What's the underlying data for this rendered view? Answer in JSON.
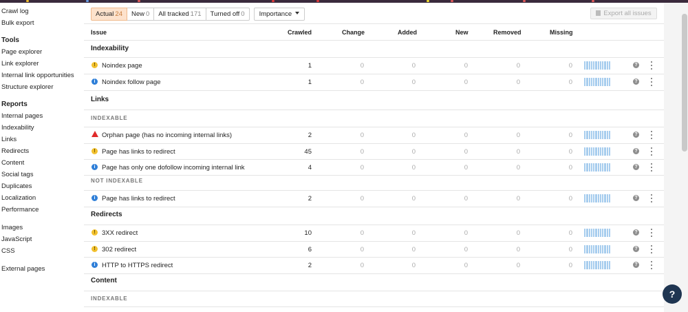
{
  "sidebar": {
    "top_items": [
      "Crawl log",
      "Bulk export"
    ],
    "tools_heading": "Tools",
    "tools": [
      "Page explorer",
      "Link explorer",
      "Internal link opportunities",
      "Structure explorer"
    ],
    "reports_heading": "Reports",
    "reports": [
      "Internal pages",
      "Indexability",
      "Links",
      "Redirects",
      "Content",
      "Social tags",
      "Duplicates",
      "Localization",
      "Performance"
    ],
    "more": [
      "Images",
      "JavaScript",
      "CSS"
    ],
    "external": "External pages"
  },
  "filters": {
    "actual_label": "Actual",
    "actual_count": "24",
    "new_label": "New",
    "new_count": "0",
    "all_label": "All tracked",
    "all_count": "171",
    "off_label": "Turned off",
    "off_count": "0",
    "importance_label": "Importance",
    "export_label": "Export all issues"
  },
  "columns": {
    "issue": "Issue",
    "crawled": "Crawled",
    "change": "Change",
    "added": "Added",
    "new": "New",
    "removed": "Removed",
    "missing": "Missing"
  },
  "sections": {
    "indexability": "Indexability",
    "links": "Links",
    "redirects": "Redirects",
    "content": "Content",
    "indexable": "INDEXABLE",
    "not_indexable": "NOT INDEXABLE",
    "content_indexable": "INDEXABLE"
  },
  "rows": [
    {
      "severity": "warning",
      "name": "Noindex page",
      "crawled": "1",
      "change": "0",
      "added": "0",
      "new": "0",
      "removed": "0",
      "missing": "0"
    },
    {
      "severity": "notice",
      "name": "Noindex follow page",
      "crawled": "1",
      "change": "0",
      "added": "0",
      "new": "0",
      "removed": "0",
      "missing": "0"
    },
    {
      "severity": "error",
      "name": "Orphan page (has no incoming internal links)",
      "crawled": "2",
      "change": "0",
      "added": "0",
      "new": "0",
      "removed": "0",
      "missing": "0"
    },
    {
      "severity": "warning",
      "name": "Page has links to redirect",
      "crawled": "45",
      "change": "0",
      "added": "0",
      "new": "0",
      "removed": "0",
      "missing": "0"
    },
    {
      "severity": "notice",
      "name": "Page has only one dofollow incoming internal link",
      "crawled": "4",
      "change": "0",
      "added": "0",
      "new": "0",
      "removed": "0",
      "missing": "0"
    },
    {
      "severity": "notice",
      "name": "Page has links to redirect",
      "crawled": "2",
      "change": "0",
      "added": "0",
      "new": "0",
      "removed": "0",
      "missing": "0"
    },
    {
      "severity": "warning",
      "name": "3XX redirect",
      "crawled": "10",
      "change": "0",
      "added": "0",
      "new": "0",
      "removed": "0",
      "missing": "0"
    },
    {
      "severity": "warning",
      "name": "302 redirect",
      "crawled": "6",
      "change": "0",
      "added": "0",
      "new": "0",
      "removed": "0",
      "missing": "0"
    },
    {
      "severity": "notice",
      "name": "HTTP to HTTPS redirect",
      "crawled": "2",
      "change": "0",
      "added": "0",
      "new": "0",
      "removed": "0",
      "missing": "0"
    }
  ],
  "icons": {
    "warning": "exclamation-circle-yellow",
    "notice": "info-circle-blue",
    "error": "warning-triangle-red",
    "help": "question-circle-icon",
    "more": "vertical-dots-icon"
  },
  "colors": {
    "warning": "#f2c12e",
    "notice": "#2f7fd8",
    "error": "#e02a2a",
    "active_filter": "#fde2cc",
    "sparkline": "#a7cdee",
    "help_fab": "#1f3551"
  },
  "help_fab_label": "?"
}
